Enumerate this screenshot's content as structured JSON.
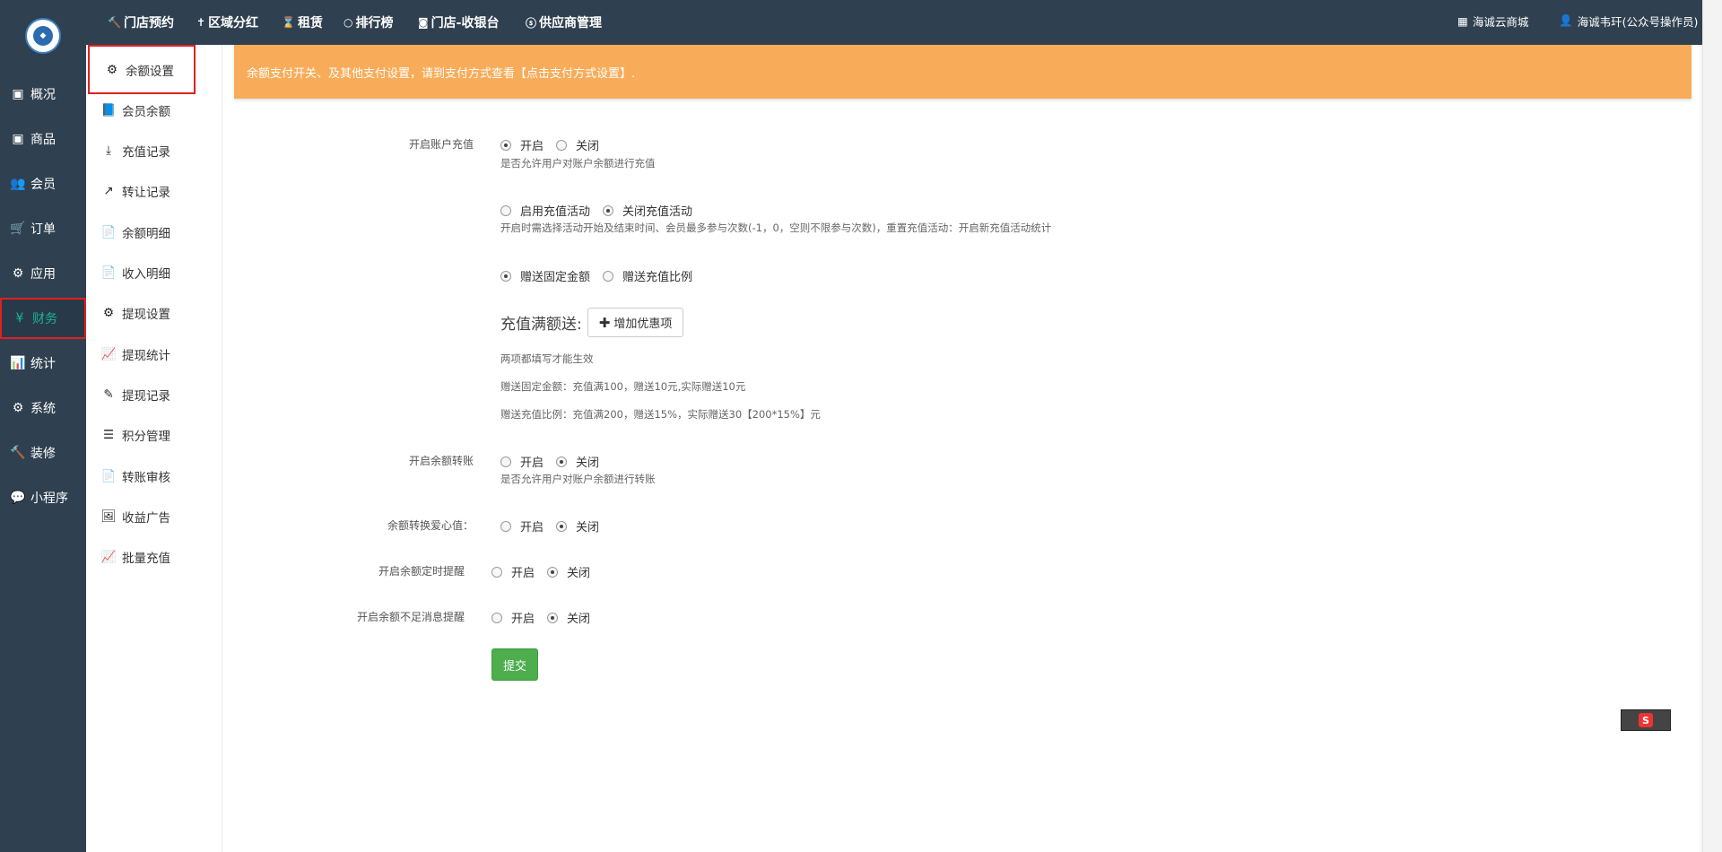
{
  "mainnav": {
    "items": [
      {
        "label": "概况",
        "icon": "archive-icon",
        "glyph": "▣"
      },
      {
        "label": "商品",
        "icon": "box-icon",
        "glyph": "▣"
      },
      {
        "label": "会员",
        "icon": "users-icon",
        "glyph": "👥"
      },
      {
        "label": "订单",
        "icon": "cart-icon",
        "glyph": "🛒"
      },
      {
        "label": "应用",
        "icon": "cubes-icon",
        "glyph": "⚙"
      },
      {
        "label": "财务",
        "icon": "yen-icon",
        "glyph": "¥"
      },
      {
        "label": "统计",
        "icon": "bar-chart-icon",
        "glyph": "📊"
      },
      {
        "label": "系统",
        "icon": "cogs-icon",
        "glyph": "⚙"
      },
      {
        "label": "装修",
        "icon": "gavel-icon",
        "glyph": "🔨"
      },
      {
        "label": "小程序",
        "icon": "wechat-icon",
        "glyph": "💬"
      }
    ],
    "active_index": 5
  },
  "topnav": {
    "items": [
      {
        "label": "门店预约",
        "glyph": "🔨"
      },
      {
        "label": "区域分红",
        "glyph": "✝"
      },
      {
        "label": "租赁",
        "glyph": "⌛"
      },
      {
        "label": "排行榜",
        "glyph": "○"
      },
      {
        "label": "门店-收银台",
        "glyph": "◙"
      },
      {
        "label": "供应商管理",
        "glyph": "ⓢ"
      }
    ],
    "shop_link": "海诚云商城",
    "user": "海诚韦玕(公众号操作员)"
  },
  "subnav": {
    "items": [
      {
        "label": "余额设置",
        "icon": "gear-icon",
        "glyph": "⚙"
      },
      {
        "label": "会员余额",
        "icon": "book-icon",
        "glyph": "📘"
      },
      {
        "label": "充值记录",
        "icon": "download-icon",
        "glyph": "⤓"
      },
      {
        "label": "转让记录",
        "icon": "external-link-icon",
        "glyph": "↗"
      },
      {
        "label": "余额明细",
        "icon": "file-icon",
        "glyph": "📄"
      },
      {
        "label": "收入明细",
        "icon": "file-icon",
        "glyph": "📄"
      },
      {
        "label": "提现设置",
        "icon": "gear-icon",
        "glyph": "⚙"
      },
      {
        "label": "提现统计",
        "icon": "line-chart-icon",
        "glyph": "📈"
      },
      {
        "label": "提现记录",
        "icon": "pencil-icon",
        "glyph": "✎"
      },
      {
        "label": "积分管理",
        "icon": "database-icon",
        "glyph": "☰"
      },
      {
        "label": "转账审核",
        "icon": "file-icon",
        "glyph": "📄"
      },
      {
        "label": "收益广告",
        "icon": "image-icon",
        "glyph": "🖼"
      },
      {
        "label": "批量充值",
        "icon": "line-chart-icon",
        "glyph": "📈"
      }
    ],
    "active_index": 0
  },
  "alert": {
    "text": "余额支付开关、及其他支付设置，请到支付方式查看【点击支付方式设置】."
  },
  "form": {
    "recharge": {
      "label": "开启账户充值",
      "options": [
        "开启",
        "关闭"
      ],
      "selected": 0,
      "help": "是否允许用户对账户余额进行充值"
    },
    "activity": {
      "options": [
        "启用充值活动",
        "关闭充值活动"
      ],
      "selected": 1,
      "help": "开启时需选择活动开始及结束时间、会员最多参与次数(-1，0，空则不限参与次数)，重置充值活动：开启新充值活动统计"
    },
    "gift_type": {
      "options": [
        "赠送固定金额",
        "赠送充值比例"
      ],
      "selected": 0
    },
    "tier": {
      "title": "充值满额送:",
      "add_button": "增加优惠项",
      "note1": "两项都填写才能生效",
      "note2": "赠送固定金额：充值满100，赠送10元,实际赠送10元",
      "note3": "赠送充值比例：充值满200，赠送15%，实际赠送30【200*15%】元"
    },
    "transfer": {
      "label": "开启余额转账",
      "options": [
        "开启",
        "关闭"
      ],
      "selected": 1,
      "help": "是否允许用户对账户余额进行转账"
    },
    "love": {
      "label": "余额转换爱心值：",
      "options": [
        "开启",
        "关闭"
      ],
      "selected": 1
    },
    "timed_remind": {
      "label": "开启余额定时提醒",
      "options": [
        "开启",
        "关闭"
      ],
      "selected": 1
    },
    "low_remind": {
      "label": "开启余额不足消息提醒",
      "options": [
        "开启",
        "关闭"
      ],
      "selected": 1
    },
    "submit": "提交"
  },
  "colors": {
    "sidebar": "#2f4050",
    "accent": "#1ab394",
    "alert": "#f8ac59",
    "submit": "#4cae4c"
  }
}
